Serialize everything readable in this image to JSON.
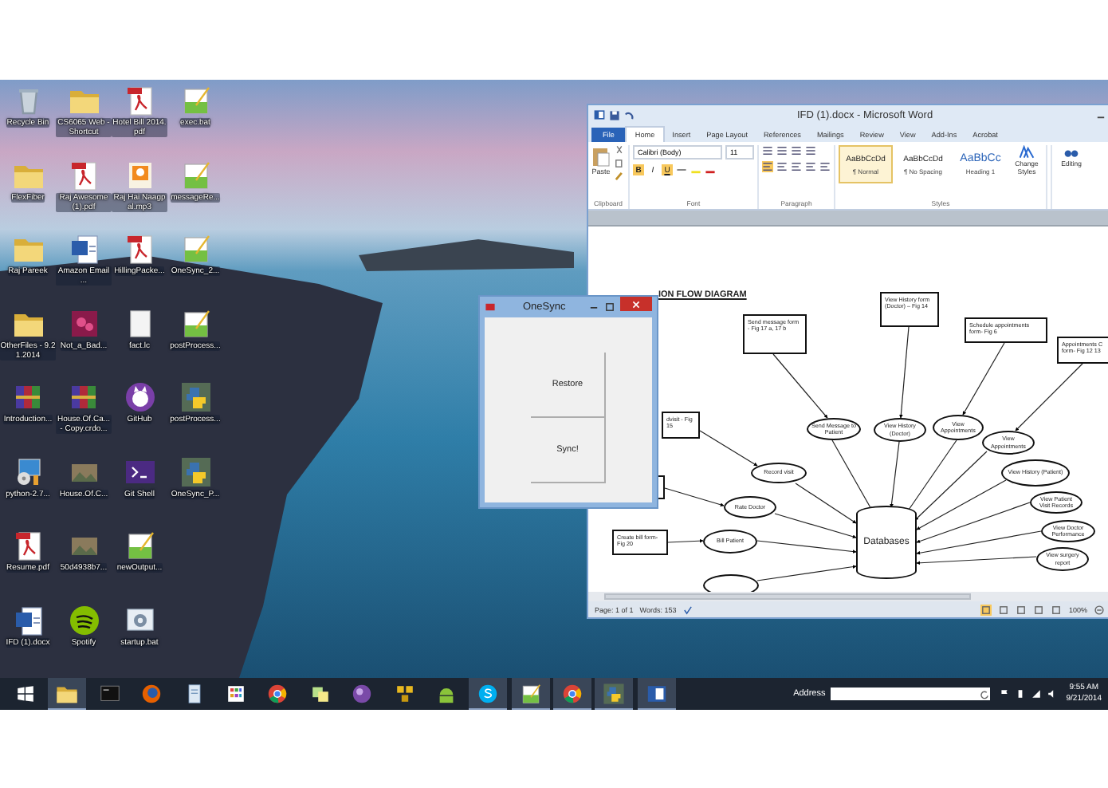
{
  "desktop_rows": [
    {
      "icons": [
        {
          "label": "Recycle Bin",
          "kind": "bin"
        },
        {
          "label": "CS6065 Web - Shortcut",
          "kind": "folder"
        },
        {
          "label": "Hotel Bill 2014.pdf",
          "kind": "pdf"
        },
        {
          "label": "exec.bat",
          "kind": "notepad"
        }
      ]
    },
    {
      "icons": [
        {
          "label": "FlexFiber",
          "kind": "folder"
        },
        {
          "label": "Raj Awesome (1).pdf",
          "kind": "pdf"
        },
        {
          "label": "Raj Hai Naagpal.mp3",
          "kind": "media"
        },
        {
          "label": "messageRe...",
          "kind": "notepad"
        }
      ]
    },
    {
      "icons": [
        {
          "label": "Raj Pareek",
          "kind": "folder"
        },
        {
          "label": "Amazon Email ...",
          "kind": "word"
        },
        {
          "label": "HillingPacke...",
          "kind": "pdf"
        },
        {
          "label": "OneSync_2...",
          "kind": "notepad"
        }
      ]
    },
    {
      "icons": [
        {
          "label": "OtherFiles - 9.21.2014",
          "kind": "folder"
        },
        {
          "label": "Not_a_Bad...",
          "kind": "game"
        },
        {
          "label": "fact.lc",
          "kind": "blank"
        },
        {
          "label": "postProcess...",
          "kind": "notepad"
        }
      ]
    },
    {
      "icons": [
        {
          "label": "Introduction...",
          "kind": "archive"
        },
        {
          "label": "House.Of.Ca... - Copy.crdo...",
          "kind": "archive"
        },
        {
          "label": "GitHub",
          "kind": "github"
        },
        {
          "label": "postProcess...",
          "kind": "python"
        }
      ]
    },
    {
      "icons": [
        {
          "label": "python-2.7...",
          "kind": "installer"
        },
        {
          "label": "House.Of.C...",
          "kind": "image"
        },
        {
          "label": "Git Shell",
          "kind": "shell"
        },
        {
          "label": "OneSync_P...",
          "kind": "python"
        }
      ]
    },
    {
      "icons": [
        {
          "label": "Resume.pdf",
          "kind": "pdf"
        },
        {
          "label": "50d4938b7...",
          "kind": "image"
        },
        {
          "label": "newOutput...",
          "kind": "notepad"
        }
      ]
    },
    {
      "icons": [
        {
          "label": "IFD (1).docx",
          "kind": "word"
        },
        {
          "label": "Spotify",
          "kind": "spotify"
        },
        {
          "label": "startup.bat",
          "kind": "gear"
        }
      ]
    }
  ],
  "word_window": {
    "title": "IFD (1).docx - Microsoft Word",
    "tabs": [
      {
        "label": "File",
        "kind": "backstage",
        "selected": false
      },
      {
        "label": "Home",
        "kind": "tab",
        "selected": true
      },
      {
        "label": "Insert",
        "kind": "tab",
        "selected": false
      },
      {
        "label": "Page Layout",
        "kind": "tab",
        "selected": false
      },
      {
        "label": "References",
        "kind": "tab",
        "selected": false
      },
      {
        "label": "Mailings",
        "kind": "tab",
        "selected": false
      },
      {
        "label": "Review",
        "kind": "tab",
        "selected": false
      },
      {
        "label": "View",
        "kind": "tab",
        "selected": false
      },
      {
        "label": "Add-Ins",
        "kind": "tab",
        "selected": false
      },
      {
        "label": "Acrobat",
        "kind": "tab",
        "selected": false
      }
    ],
    "ribbon": {
      "paste_label": "Paste",
      "font_name": "Calibri (Body)",
      "font_size": "11",
      "font_buttons": [
        {
          "label": "B",
          "on": true
        },
        {
          "label": "I",
          "on": false
        },
        {
          "label": "U",
          "on": true
        }
      ],
      "styles": [
        {
          "sample": "AaBbCcDd",
          "name": "¶ Normal",
          "selected": true
        },
        {
          "sample": "AaBbCcDd",
          "name": "¶ No Spacing",
          "selected": false
        },
        {
          "sample": "AaBbCc",
          "name": "Heading 1",
          "selected": false
        }
      ],
      "change_styles": "Change Styles",
      "editing": "Editing",
      "groups": [
        "Clipboard",
        "Font",
        "Paragraph",
        "Styles"
      ]
    },
    "document": {
      "heading": "ION FLOW DIAGRAM",
      "nodes": [
        {
          "kind": "box",
          "text": "Send message form - Fig 17 a, 17 b"
        },
        {
          "kind": "box",
          "text": "View History form (Doctor) – Fig 14"
        },
        {
          "kind": "box",
          "text": "Schedule appointments form- Fig 6"
        },
        {
          "kind": "box",
          "text": "Appointments C form- Fig 12 13"
        },
        {
          "kind": "box",
          "text": "dvisit - Fig 15"
        },
        {
          "kind": "ellipse",
          "text": "Send Message to Patient"
        },
        {
          "kind": "ellipse",
          "text": "View History (Doctor)"
        },
        {
          "kind": "ellipse",
          "text": "View Appointments"
        },
        {
          "kind": "ellipse",
          "text": "View Appointments"
        },
        {
          "kind": "ellipse",
          "text": "Record visit"
        },
        {
          "kind": "ellipse",
          "text": "View History (Patient)"
        },
        {
          "kind": "box"
        },
        {
          "kind": "ellipse",
          "text": "Rate Doctor"
        },
        {
          "kind": "cylinder",
          "text": "Databases"
        },
        {
          "kind": "ellipse",
          "text": "View Patient Visit Records"
        },
        {
          "kind": "ellipse",
          "text": "View Doctor Performance"
        },
        {
          "kind": "box",
          "text": "Create bill form- Fig 20"
        },
        {
          "kind": "ellipse",
          "text": "Bill Patient"
        },
        {
          "kind": "ellipse",
          "text": "View surgery report"
        },
        {
          "kind": "ellipse"
        }
      ]
    },
    "status_bar": {
      "page": "Page: 1 of 1",
      "words": "Words: 153",
      "zoom": "100%"
    }
  },
  "onesync_window": {
    "title": "OneSync",
    "buttons": [
      "Restore",
      "Sync!"
    ]
  },
  "taskbar": {
    "apps": [
      {
        "kind": "start",
        "running": false
      },
      {
        "kind": "explorer",
        "running": true
      },
      {
        "kind": "terminal",
        "running": false
      },
      {
        "kind": "firefox",
        "running": false
      },
      {
        "kind": "notes",
        "running": false
      },
      {
        "kind": "apps",
        "running": false
      },
      {
        "kind": "chrome",
        "running": false
      },
      {
        "kind": "sticky",
        "running": false
      },
      {
        "kind": "orb",
        "running": false
      },
      {
        "kind": "vm",
        "running": false
      },
      {
        "kind": "android",
        "running": false
      },
      {
        "kind": "skype",
        "running": true
      },
      {
        "kind": "notepad",
        "running": true
      },
      {
        "kind": "chrome",
        "running": true
      },
      {
        "kind": "python",
        "running": true
      },
      {
        "kind": "wordapp",
        "running": true
      }
    ],
    "address_label": "Address",
    "clock_time": "9:55 AM",
    "clock_date": "9/21/2014"
  }
}
